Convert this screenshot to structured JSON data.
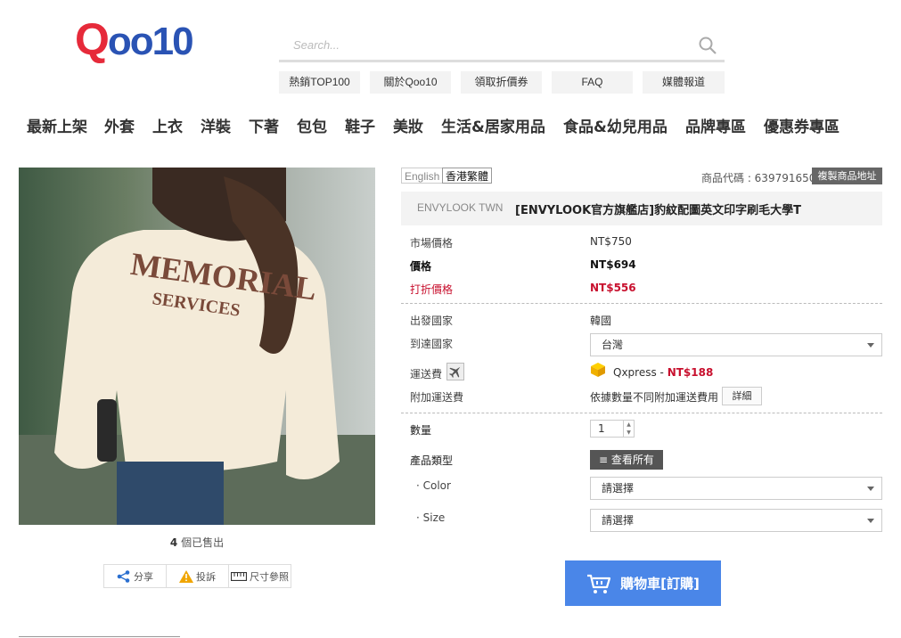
{
  "header": {
    "logo_q": "Q",
    "logo_rest": "oo10",
    "search_placeholder": "Search...",
    "quick_links": [
      "熱銷TOP100",
      "關於Qoo10",
      "領取折價券",
      "FAQ",
      "媒體報道"
    ]
  },
  "categories": [
    "最新上架",
    "外套",
    "上衣",
    "洋裝",
    "下著",
    "包包",
    "鞋子",
    "美妝",
    "生活&居家用品",
    "食品&幼兒用品",
    "品牌專區",
    "優惠券專區"
  ],
  "product": {
    "image_text_line1": "MEMORIAL",
    "image_text_line2": "SERVICES",
    "sold_count": "4",
    "sold_suffix": " 個已售出",
    "actions": {
      "share": "分享",
      "report": "投訴",
      "size": "尺寸參照"
    }
  },
  "panel": {
    "lang_en": "English",
    "lang_hk": "香港繁體",
    "code_label": "商品代碼 : 639791650",
    "copy_button": "複製商品地址",
    "shop": "ENVYLOOK TWN",
    "title": "[ENVYLOOK官方旗艦店]豹紋配圖英文印字刷毛大學T",
    "market_price_label": "市場價格",
    "market_price": "NT$750",
    "price_label": "價格",
    "price": "NT$694",
    "discount_label": "打折價格",
    "discount_price": "NT$556",
    "origin_label": "出發國家",
    "origin": "韓國",
    "dest_label": "到達國家",
    "dest": "台灣",
    "shipping_label": "運送費",
    "shipping_method": "Qxpress - ",
    "shipping_fee": "NT$188",
    "extra_label": "附加運送費",
    "extra_text": "依據數量不同附加運送費用",
    "detail_button": "詳細",
    "qty_label": "數量",
    "qty": "1",
    "type_label": "產品類型",
    "view_all": "查看所有",
    "color_label": "· Color",
    "size_label": "· Size",
    "select_placeholder": "請選擇",
    "cart_button": "購物車[訂購]"
  },
  "colors": {
    "accent": "#4a86e8",
    "sale": "#c8102e",
    "logo_red": "#e62a3a",
    "logo_blue": "#2a53b4"
  }
}
